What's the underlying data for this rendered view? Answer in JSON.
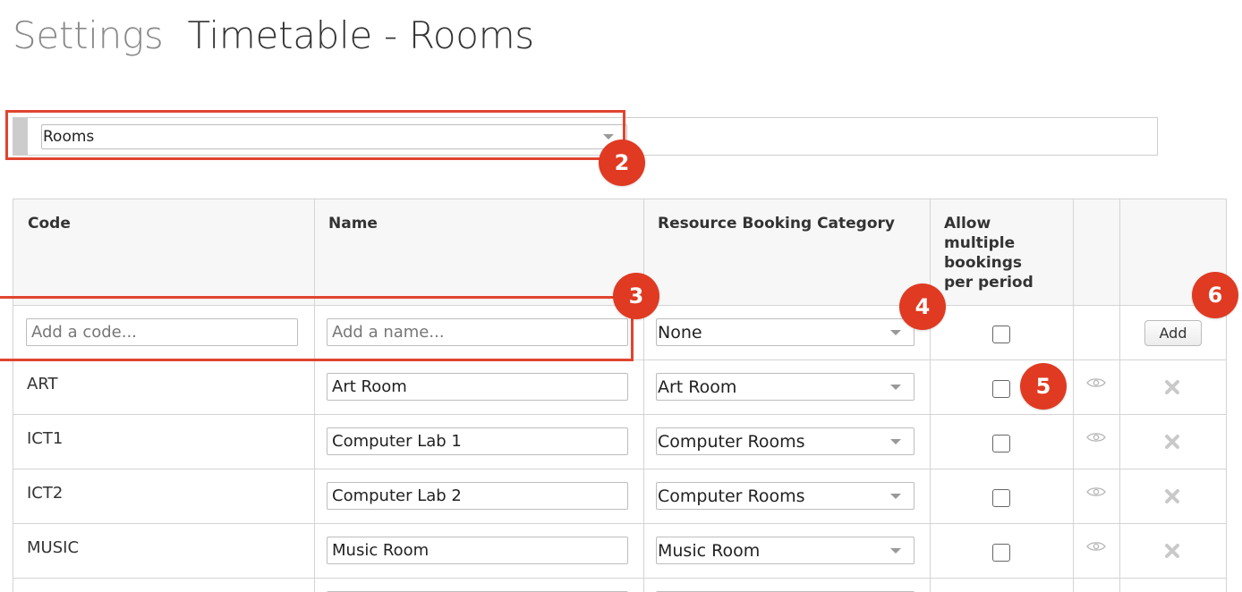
{
  "header": {
    "crumb": "Settings",
    "title": "Timetable - Rooms"
  },
  "filter": {
    "selected": "Rooms"
  },
  "table": {
    "columns": [
      "Code",
      "Name",
      "Resource Booking Category",
      "Allow multiple bookings per period",
      "",
      ""
    ],
    "new_row": {
      "code_placeholder": "Add a code...",
      "name_placeholder": "Add a name...",
      "category": "None",
      "allow_multiple": false,
      "add_label": "Add"
    },
    "rows": [
      {
        "code": "ART",
        "name": "Art Room",
        "category": "Art Room",
        "allow_multiple": false
      },
      {
        "code": "ICT1",
        "name": "Computer Lab 1",
        "category": "Computer Rooms",
        "allow_multiple": false
      },
      {
        "code": "ICT2",
        "name": "Computer Lab 2",
        "category": "Computer Rooms",
        "allow_multiple": false
      },
      {
        "code": "MUSIC",
        "name": "Music Room",
        "category": "Music Room",
        "allow_multiple": false
      }
    ]
  },
  "annotations": {
    "badges": [
      "2",
      "3",
      "4",
      "5",
      "6"
    ],
    "color": "#e03a22"
  },
  "icons": {
    "view": "eye-icon",
    "delete": "close-icon",
    "dropdown": "chevron-down-icon"
  },
  "colors": {
    "accent": "#e03a22",
    "header_bg": "#f7f7f7",
    "grid_line": "#d4d4d4"
  }
}
